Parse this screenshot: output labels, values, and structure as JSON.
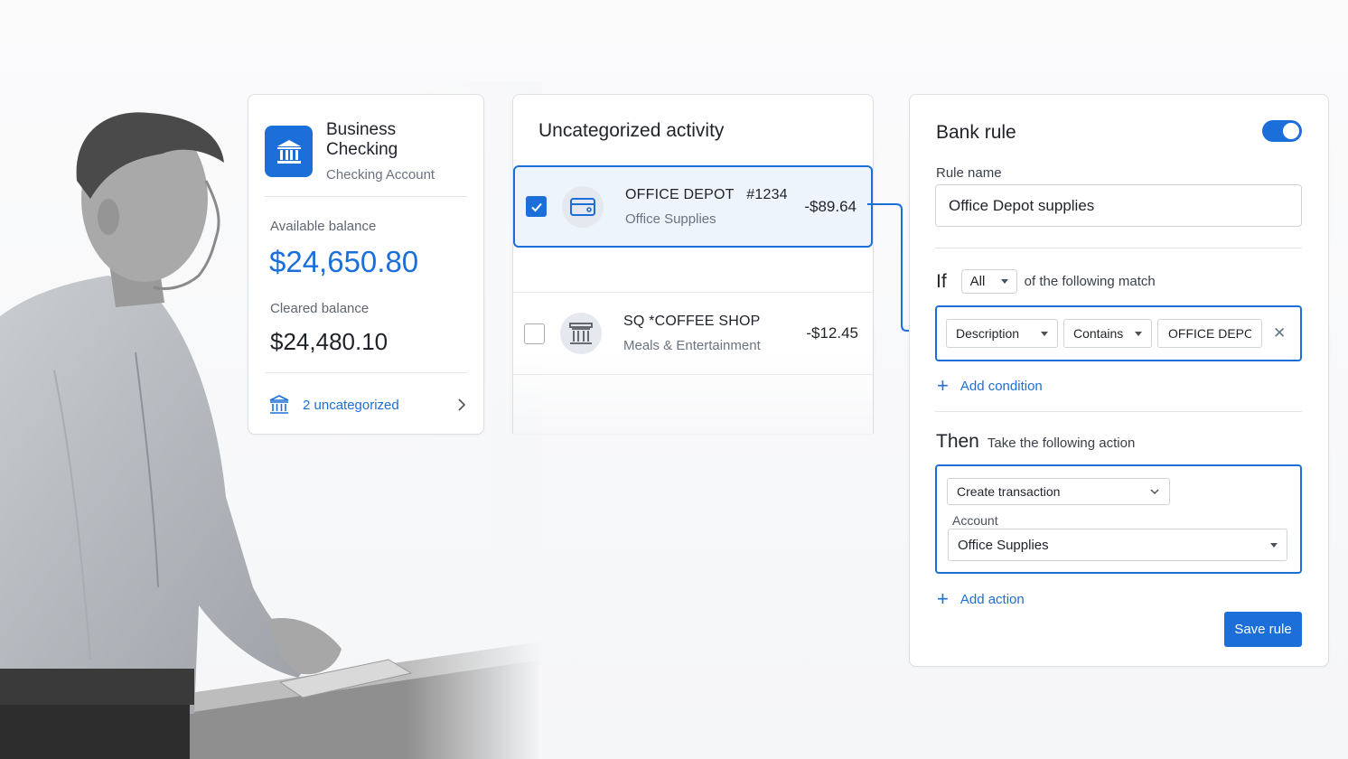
{
  "account": {
    "name": "Business Checking",
    "type": "Checking Account",
    "available_label": "Available balance",
    "available_value": "$24,650.80",
    "cleared_label": "Cleared balance",
    "cleared_value": "$24,480.10",
    "uncategorized_link": "2 uncategorized",
    "icon": "bank-icon"
  },
  "uncategorized": {
    "title": "Uncategorized activity",
    "transactions": [
      {
        "name": "OFFICE DEPOT   #1234",
        "category": "Office Supplies",
        "amount": "-$89.64",
        "checked": true,
        "icon": "card-icon"
      },
      {
        "name": "SQ *COFFEE SHOP",
        "category": "Meals & Entertainment",
        "amount": "-$12.45",
        "checked": false,
        "icon": "store-icon"
      }
    ]
  },
  "rule": {
    "title": "Bank rule",
    "enabled": true,
    "name_label": "Rule name",
    "name_value": "Office Depot supplies",
    "if_word": "If",
    "match_mode": "All",
    "match_rest": "of the following match",
    "condition": {
      "field": "Description",
      "operator": "Contains",
      "value": "OFFICE DEPOT"
    },
    "add_condition": "Add condition",
    "then_word": "Then",
    "then_rest": "Take the following action",
    "action_type": "Create transaction",
    "account_label": "Account",
    "account_value": "Office Supplies",
    "add_action": "Add action",
    "save_label": "Save rule"
  },
  "colors": {
    "accent": "#1c6fd8",
    "selected_bg": "#eef4fc"
  }
}
